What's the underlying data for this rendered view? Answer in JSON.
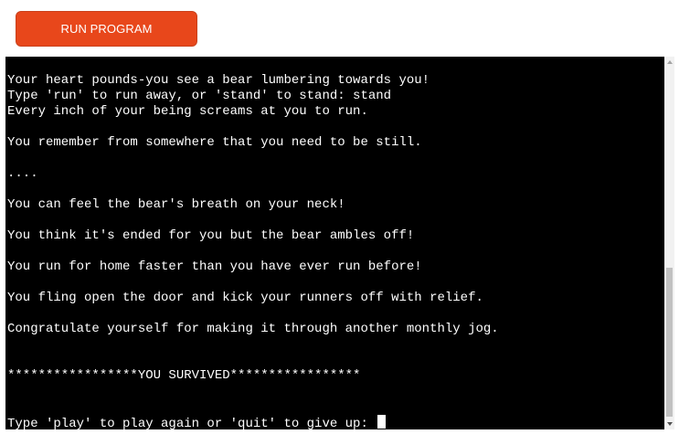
{
  "toolbar": {
    "run_label": "RUN PROGRAM"
  },
  "terminal": {
    "lines": [
      "Your heart pounds-you see a bear lumbering towards you!",
      "Type 'run' to run away, or 'stand' to stand: stand",
      "Every inch of your being screams at you to run.",
      "You remember from somewhere that you need to be still.",
      "....",
      "You can feel the bear's breath on your neck!",
      "You think it's ended for you but the bear ambles off!",
      "You run for home faster than you have ever run before!",
      "You fling open the door and kick your runners off with relief.",
      "Congratulate yourself for making it through another monthly jog.",
      "*****************YOU SURVIVED*****************",
      "Type 'play' to play again or 'quit' to give up: "
    ]
  },
  "colors": {
    "button_bg": "#e8471b",
    "terminal_bg": "#000000",
    "terminal_fg": "#ffffff"
  }
}
